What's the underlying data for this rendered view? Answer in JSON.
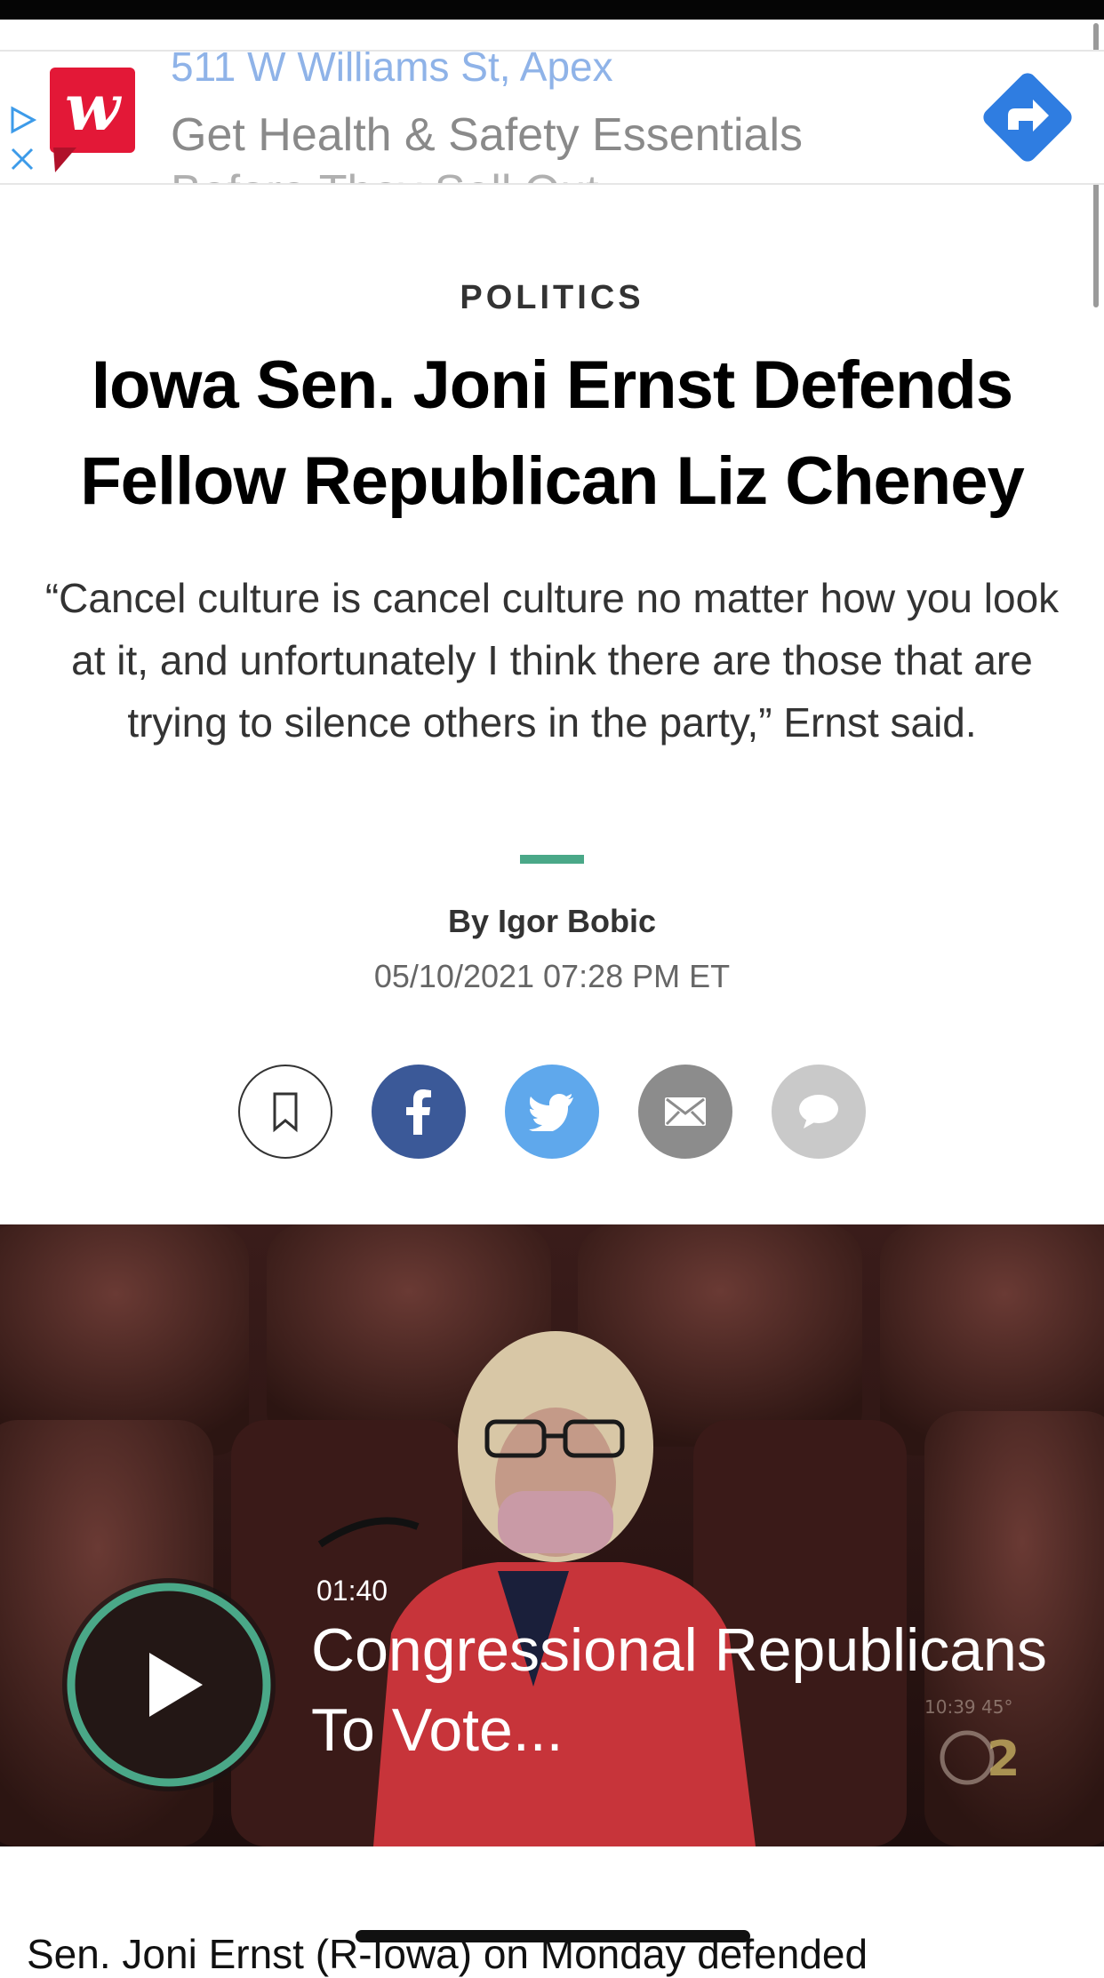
{
  "ad": {
    "address": "511 W Williams St, Apex",
    "headline": "Get Health & Safety Essentials",
    "subline": "Before They Sell Out",
    "brand_color": "#e31837",
    "cta_color": "#2f7de1"
  },
  "article": {
    "section": "POLITICS",
    "headline": "Iowa Sen. Joni Ernst Defends Fellow Republican Liz Cheney",
    "dek": "“Cancel culture is cancel culture no matter how you look at it, and unfortunately I think there are those that are trying to silence others in the party,” Ernst said.",
    "byline": "By Igor Bobic",
    "timestamp": "05/10/2021 07:28 PM ET",
    "accent_color": "#4aa888"
  },
  "share": {
    "icons": [
      "bookmark-icon",
      "facebook-icon",
      "twitter-icon",
      "email-icon",
      "comment-icon"
    ],
    "colors": {
      "facebook": "#3b5998",
      "twitter": "#5fa8ec",
      "email": "#8c8c8c",
      "comment": "#c9c9c9"
    }
  },
  "video": {
    "duration": "01:40",
    "title": "Congressional Republicans To Vote..."
  },
  "body": {
    "first_line": "Sen. Joni Ernst (R-Iowa) on Monday defended"
  }
}
